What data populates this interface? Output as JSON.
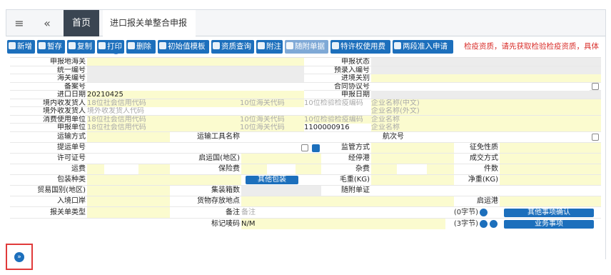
{
  "tabbar": {
    "home": "首页",
    "active_tab": "进口报关单整合申报",
    "close_glyph": "×"
  },
  "toolbar": {
    "buttons": [
      "新增",
      "暂存",
      "复制",
      "打印",
      "删除",
      "初始值模板",
      "资质查询",
      "附注",
      "随附单据",
      "特许权使用费",
      "两段准入申请"
    ],
    "notice": "检疫资质，请先获取检验检疫资质，具体"
  },
  "form": {
    "declare_customs": "申报地海关",
    "declare_status": "申报状态",
    "uni_no": "统一编号",
    "pre_entry_no": "预录入编号",
    "customs_no": "海关编号",
    "entry_port": "进境关别",
    "record_no": "备案号",
    "contract_no": "合同协议号",
    "import_date": "进口日期",
    "import_date_val": "20210425",
    "declare_date": "申报日期",
    "consignee": "境内收发货人",
    "overseas_consignor": "境外收发货人",
    "consumer": "消费使用单位",
    "declarant": "申报单位",
    "ph_credit": "18位社会信用代码",
    "ph_customs_code": "10位海关代码",
    "ph_ciq_code": "10位检验检疫编码",
    "ph_name_cn": "企业名称(中文)",
    "ph_name_en": "企业名称(外文)",
    "ph_overseas": "境外收发货人代码",
    "ph_name": "企业名称",
    "declarant_ciq_val": "1100000916",
    "transport_mode": "运输方式",
    "transport_tool": "运输工具名称",
    "voyage_no": "航次号",
    "bill_no": "提运单号",
    "supervision_mode": "监管方式",
    "exemption": "征免性质",
    "license_no": "许可证号",
    "departure_country": "启运国(地区)",
    "transit_port": "经停港",
    "deal_mode": "成交方式",
    "freight": "运费",
    "insurance": "保险费",
    "misc_fee": "杂费",
    "pieces": "件数",
    "package_type": "包装种类",
    "other_package_btn": "其他包装",
    "gross_weight": "毛重(KG)",
    "net_weight": "净重(KG)",
    "trade_country": "贸易国别(地区)",
    "container_count": "集装箱数",
    "attached_cert": "随附单证",
    "entry_port2": "入境口岸",
    "goods_location": "货物存放地点",
    "departure_port": "启运港",
    "decl_type": "报关单类型",
    "remark": "备注",
    "remark_ph": "备注",
    "remark_count": "(0字节)",
    "other_confirm_btn": "其他事项确认",
    "mark_no": "标记唛码",
    "mark_val": "N/M",
    "mark_count": "(3字节)",
    "business_btn": "业务事项"
  },
  "expand": {
    "glyph": "»"
  }
}
